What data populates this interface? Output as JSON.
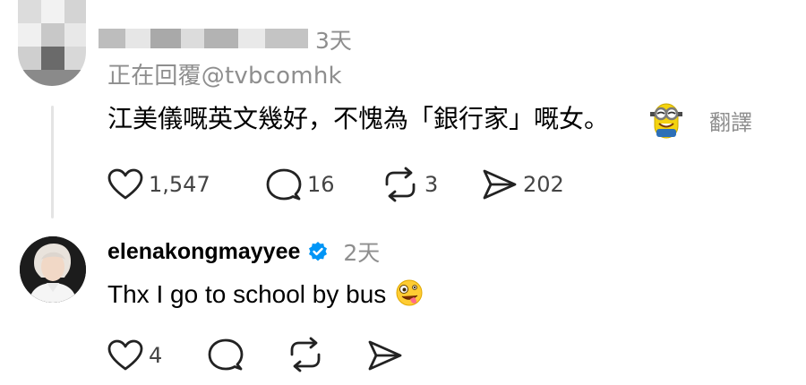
{
  "post1": {
    "time": "3天",
    "reply_to": "正在回覆@tvbcomhk",
    "text": "江美儀嘅英文幾好，不愧為「銀行家」嘅女。",
    "translate": "翻譯",
    "actions": {
      "likes": "1,547",
      "comments": "16",
      "reposts": "3",
      "shares": "202"
    }
  },
  "post2": {
    "username": "elenakongmayyee",
    "verified": true,
    "time": "2天",
    "text": "Thx I go to school by bus",
    "actions": {
      "likes": "4"
    }
  },
  "colors": {
    "muted": "#8e8e8e",
    "verified_badge": "#0095f6",
    "thread_line": "#e4e4e4"
  }
}
